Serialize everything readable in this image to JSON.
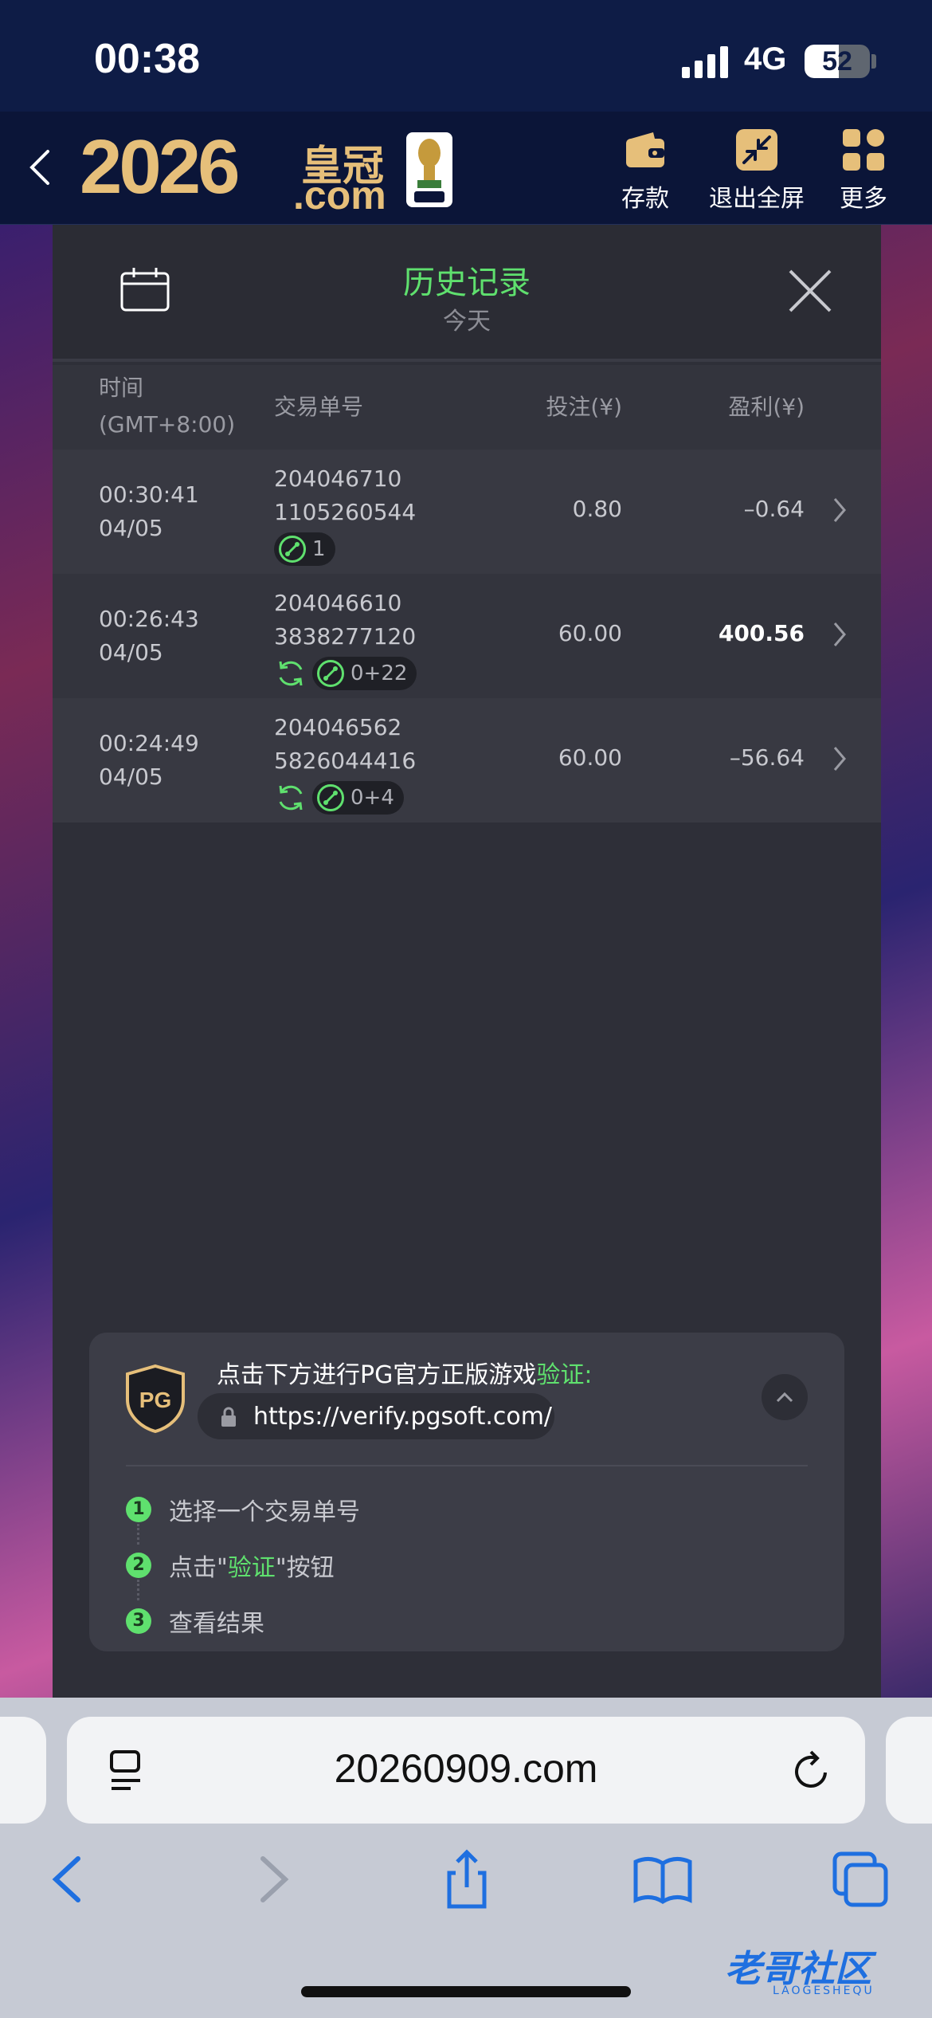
{
  "status_bar": {
    "time": "00:38",
    "network": "4G",
    "battery": "52",
    "battery_level": 0.52
  },
  "header": {
    "logo_text": "2026",
    "logo_cn": "皇冠",
    "logo_com": ".com",
    "buttons": [
      {
        "label": "存款",
        "icon": "wallet-icon"
      },
      {
        "label": "退出全屏",
        "icon": "exit-fullscreen-icon"
      },
      {
        "label": "更多",
        "icon": "grid-more-icon"
      }
    ]
  },
  "history": {
    "title": "历史记录",
    "subtitle": "今天",
    "columns": {
      "time": "时间",
      "tz": "(GMT+8:00)",
      "txn": "交易单号",
      "bet": "投注(¥)",
      "profit": "盈利(¥)"
    },
    "rows": [
      {
        "time": "00:30:41",
        "date": "04/05",
        "txn1": "204046710",
        "txn2": "1105260544",
        "badge": "1",
        "refresh": false,
        "bet": "0.80",
        "profit": "–0.64",
        "positive": false
      },
      {
        "time": "00:26:43",
        "date": "04/05",
        "txn1": "204046610",
        "txn2": "3838277120",
        "badge": "0+22",
        "refresh": true,
        "bet": "60.00",
        "profit": "400.56",
        "positive": true
      },
      {
        "time": "00:24:49",
        "date": "04/05",
        "txn1": "204046562",
        "txn2": "5826044416",
        "badge": "0+4",
        "refresh": true,
        "bet": "60.00",
        "profit": "–56.64",
        "positive": false
      }
    ]
  },
  "verify": {
    "text_pre": "点击下方进行PG官方正版游戏",
    "text_green": "验证",
    "text_post": ":",
    "badge": "PG",
    "url": "https://verify.pgsoft.com/",
    "steps": [
      {
        "n": "1",
        "pre": "选择一个交易单号",
        "green": "",
        "post": ""
      },
      {
        "n": "2",
        "pre": "点击\"",
        "green": "验证",
        "post": "\"按钮"
      },
      {
        "n": "3",
        "pre": "查看结果",
        "green": "",
        "post": ""
      }
    ]
  },
  "browser": {
    "domain": "20260909.com"
  },
  "watermark": {
    "text": "老哥社区",
    "sub": "LAOGESHEQU"
  },
  "colors": {
    "accent_green": "#5fe06e",
    "gold": "#e6bf7a",
    "panel": "#2e2f38"
  }
}
